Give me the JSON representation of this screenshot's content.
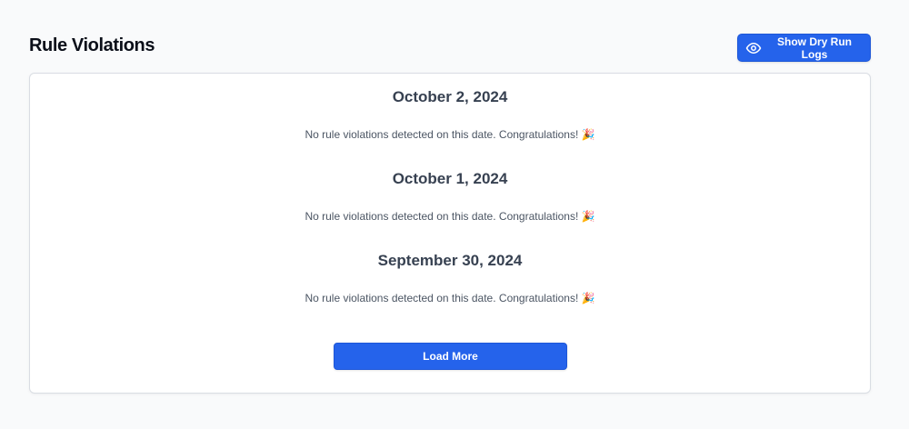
{
  "header": {
    "title": "Rule Violations",
    "dry_run_button": {
      "label": "Show Dry Run Logs",
      "icon": "eye-icon"
    }
  },
  "violations": {
    "sections": [
      {
        "date": "October 2, 2024",
        "message": "No rule violations detected on this date. Congratulations! 🎉"
      },
      {
        "date": "October 1, 2024",
        "message": "No rule violations detected on this date. Congratulations! 🎉"
      },
      {
        "date": "September 30, 2024",
        "message": "No rule violations detected on this date. Congratulations! 🎉"
      }
    ],
    "load_more_label": "Load More"
  },
  "colors": {
    "accent": "#2563eb",
    "page_background": "#f9fafb",
    "card_border": "#d9dde3",
    "heading": "#374151",
    "body_text": "#4b5563"
  }
}
